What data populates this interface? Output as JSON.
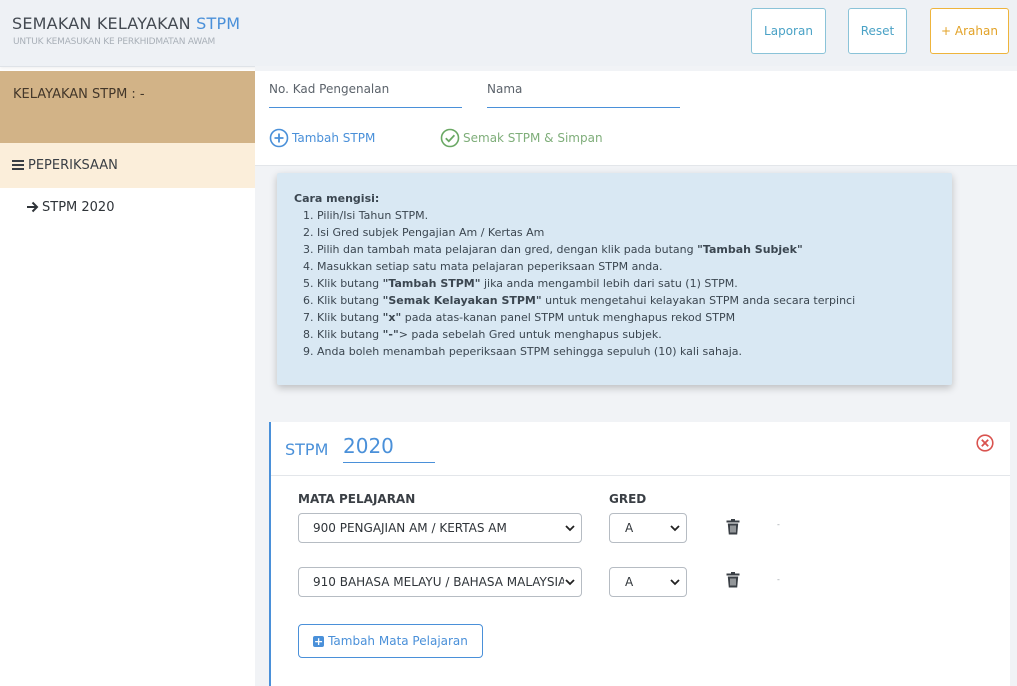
{
  "header": {
    "title_main": "SEMAKAN KELAYAKAN",
    "title_accent": "STPM",
    "subtitle": "UNTUK KEMASUKAN KE PERKHIDMATAN AWAM",
    "buttons": {
      "laporan": "Laporan",
      "reset": "Reset",
      "arahan": "+ Arahan"
    }
  },
  "sidebar": {
    "status": "KELAYAKAN STPM : -",
    "section": "PEPERIKSAAN",
    "items": [
      {
        "label": "STPM 2020"
      }
    ]
  },
  "form": {
    "ic_placeholder": "No. Kad Pengenalan",
    "name_placeholder": "Nama"
  },
  "actions": {
    "tambah_stpm": "Tambah STPM",
    "semak_simpan": "Semak STPM & Simpan"
  },
  "instructions": {
    "title": "Cara mengisi:",
    "items": [
      [
        "Pilih/Isi Tahun STPM.",
        "",
        ""
      ],
      [
        "Isi Gred subjek Pengajian Am / Kertas Am",
        "",
        ""
      ],
      [
        "Pilih dan tambah mata pelajaran dan gred, dengan klik pada butang ",
        "\"Tambah Subjek\"",
        ""
      ],
      [
        "Masukkan setiap satu mata pelajaran peperiksaan STPM anda.",
        "",
        ""
      ],
      [
        "Klik butang ",
        "\"Tambah STPM\"",
        " jika anda mengambil lebih dari satu (1) STPM."
      ],
      [
        "Klik butang ",
        "\"Semak Kelayakan STPM\"",
        " untuk mengetahui kelayakan STPM anda secara terpinci"
      ],
      [
        "Klik butang ",
        "\"x\"",
        " pada atas-kanan panel STPM untuk menghapus rekod STPM"
      ],
      [
        "Klik butang ",
        "\"-\"",
        "> pada sebelah Gred untuk menghapus subjek."
      ],
      [
        "Anda boleh menambah peperiksaan STPM sehingga sepuluh (10) kali sahaja.",
        "",
        ""
      ]
    ]
  },
  "stpm_panel": {
    "label": "STPM",
    "year": "2020",
    "col_subject": "MATA PELAJARAN",
    "col_grade": "GRED",
    "rows": [
      {
        "subject": "900 PENGAJIAN AM / KERTAS AM",
        "grade": "A",
        "mark": "-"
      },
      {
        "subject": "910 BAHASA MELAYU / BAHASA MALAYSIA",
        "grade": "A",
        "mark": "-"
      }
    ],
    "add_subject": "Tambah Mata Pelajaran"
  },
  "colors": {
    "accent": "#4a90d9",
    "sidebar_status_bg": "#d2b387",
    "sidebar_section_bg": "#fbeeda",
    "info_bg": "#d9e8f3",
    "arahan": "#e2a227",
    "success": "#7fae7a",
    "danger": "#d9534f"
  },
  "icons": [
    "menu-icon",
    "arrow-right-icon",
    "plus-circle-icon",
    "check-circle-icon",
    "close-circle-icon",
    "chevron-down-icon",
    "trash-icon",
    "plus-square-icon"
  ]
}
